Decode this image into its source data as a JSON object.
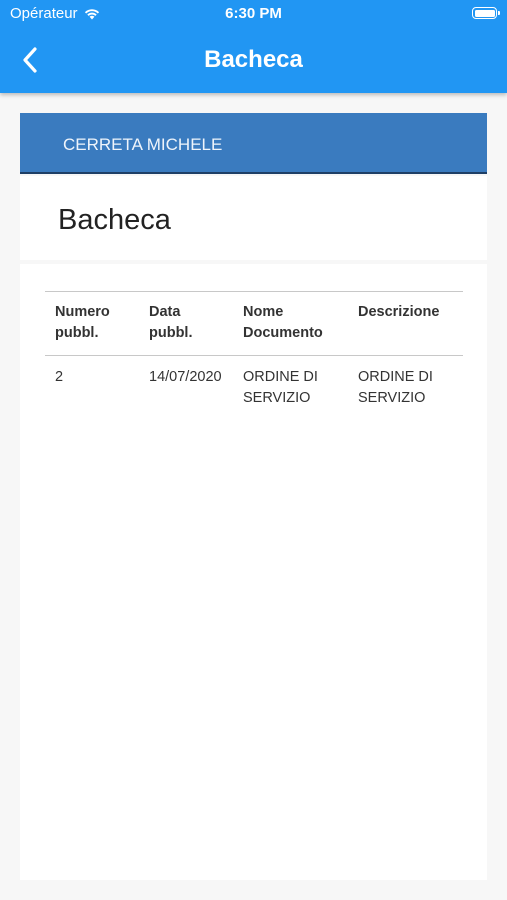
{
  "status_bar": {
    "carrier": "Opérateur",
    "time": "6:30 PM"
  },
  "nav": {
    "title": "Bacheca",
    "back_icon": "chevron-left-icon"
  },
  "user_header": {
    "name": "CERRETA MICHELE"
  },
  "section": {
    "title": "Bacheca"
  },
  "table": {
    "headers": [
      "Numero pubbl.",
      "Data pubbl.",
      "Nome Documento",
      "Descrizione"
    ],
    "rows": [
      [
        "2",
        "14/07/2020",
        "ORDINE DI SERVIZIO",
        "ORDINE DI SERVIZIO"
      ]
    ]
  },
  "colors": {
    "app_bar": "#2196f3",
    "card_header": "#3a7bbf",
    "background": "#f7f7f7"
  }
}
